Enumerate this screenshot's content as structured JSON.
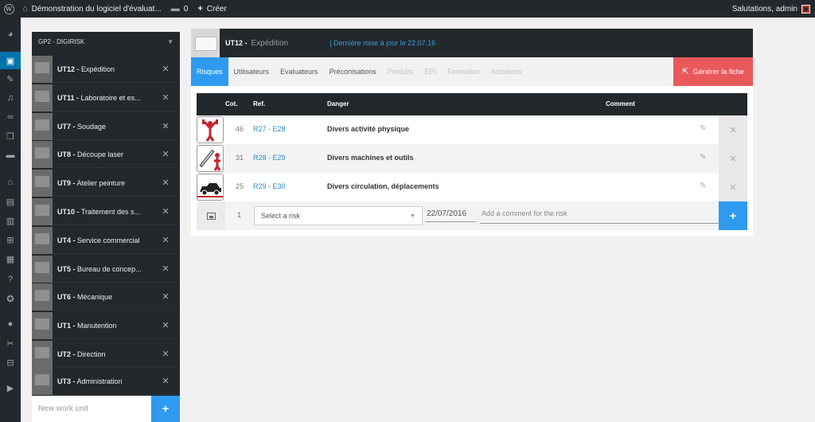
{
  "admin_bar": {
    "site_title": "Démonstration du logiciel d'évaluat...",
    "comments_count": "0",
    "create_label": "Créer",
    "greeting": "Salutations, admin"
  },
  "admin_menu": {
    "icons": [
      "dashboard-icon",
      "digirisk-icon",
      "pin-icon",
      "media-icon",
      "link-icon",
      "pages-icon",
      "comments-icon",
      "home-icon",
      "archive-icon",
      "store-icon",
      "cart-icon",
      "forms-icon",
      "help-icon",
      "accessibility-icon",
      "users-icon",
      "tools-icon",
      "settings-icon",
      "play-icon"
    ]
  },
  "work_units": {
    "group_title": "GP2 - DIGIRISK",
    "new_placeholder": "New work unit",
    "items": [
      {
        "code": "UT12 -",
        "name": "Expédition"
      },
      {
        "code": "UT11 -",
        "name": "Laboratoire et es..."
      },
      {
        "code": "UT7 -",
        "name": "Soudage"
      },
      {
        "code": "UT8 -",
        "name": "Découpe laser"
      },
      {
        "code": "UT9 -",
        "name": "Atelier peinture"
      },
      {
        "code": "UT10 -",
        "name": "Traitement des s..."
      },
      {
        "code": "UT4 -",
        "name": "Service commercial"
      },
      {
        "code": "UT5 -",
        "name": "Bureau de concep..."
      },
      {
        "code": "UT6 -",
        "name": "Mécanique"
      },
      {
        "code": "UT1 -",
        "name": "Manutention"
      },
      {
        "code": "UT2 -",
        "name": "Direction"
      },
      {
        "code": "UT3 -",
        "name": "Administration"
      }
    ]
  },
  "unit": {
    "code": "UT12 -",
    "name": "Expédition",
    "last_update": "| Dernière mise à jour le 22.07.16"
  },
  "tabs": [
    {
      "label": "Risques",
      "state": "active"
    },
    {
      "label": "Utilisateurs",
      "state": "normal"
    },
    {
      "label": "Evaluateurs",
      "state": "normal"
    },
    {
      "label": "Préconisations",
      "state": "normal"
    },
    {
      "label": "Produits",
      "state": "disabled"
    },
    {
      "label": "EPI",
      "state": "disabled"
    },
    {
      "label": "Formation",
      "state": "disabled"
    },
    {
      "label": "Accidents",
      "state": "disabled"
    }
  ],
  "generate_button": "Générer la fiche",
  "risk_table": {
    "headers": {
      "cot": "Cot.",
      "ref": "Ref.",
      "danger": "Danger",
      "comment": "Comment"
    },
    "rows": [
      {
        "cot": "46",
        "ref": "R27 - E28",
        "danger": "Divers activité physique",
        "icon": "physical-activity-icon"
      },
      {
        "cot": "31",
        "ref": "R28 - E29",
        "danger": "Divers machines et outils",
        "icon": "machine-tools-icon"
      },
      {
        "cot": "25",
        "ref": "R29 - E30",
        "danger": "Divers circulation, déplacements",
        "icon": "vehicle-icon"
      }
    ],
    "new_row": {
      "cot": "1",
      "select_placeholder": "Select a risk",
      "date": "22/07/2016",
      "comment_placeholder": "Add a comment for the risk"
    }
  },
  "colors": {
    "accent": "#2e9bf0",
    "danger_button": "#e9585b",
    "dark": "#23282d",
    "link": "#2e86c9"
  }
}
